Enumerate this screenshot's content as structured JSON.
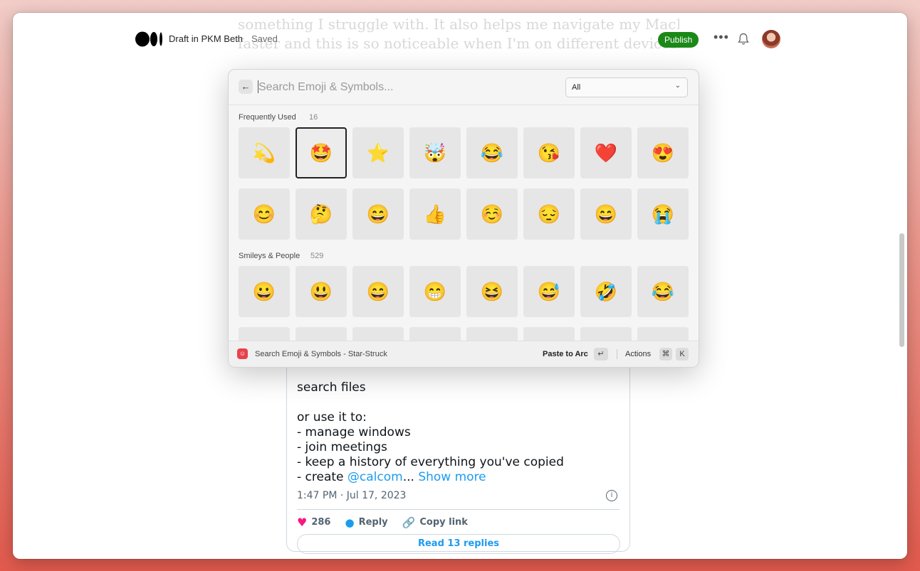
{
  "background_text": {
    "line1": "something I struggle with. It also helps me navigate my MacBook way",
    "line2": "faster and this is so noticeable when I'm on different devices."
  },
  "header": {
    "draft_label": "Draft in PKM Beth",
    "status": "Saved",
    "publish_label": "Publish",
    "more_label": "•••"
  },
  "picker": {
    "search_placeholder": "Search Emoji & Symbols...",
    "filter_value": "All",
    "frequent": {
      "label": "Frequently Used",
      "count": "16",
      "emojis": [
        "💫",
        "🤩",
        "⭐",
        "🤯",
        "😂",
        "😘",
        "❤️",
        "😍",
        "😊",
        "🤔",
        "😄",
        "👍",
        "☺️",
        "😔",
        "😄",
        "😭"
      ]
    },
    "smileys": {
      "label": "Smileys & People",
      "count": "529",
      "emojis": [
        "😀",
        "😃",
        "😄",
        "😁",
        "😆",
        "😅",
        "🤣",
        "😂"
      ]
    },
    "footer": {
      "title": "Search Emoji & Symbols - Star-Struck",
      "paste_label": "Paste to Arc",
      "enter_key": "↵",
      "actions_label": "Actions",
      "cmd_key": "⌘",
      "k_key": "K"
    }
  },
  "tweet": {
    "line_search": "search files",
    "line_or": "or use it to:",
    "line_1": "- manage windows",
    "line_2": "- join meetings",
    "line_3": "- keep a history of everything you've copied",
    "line_4_prefix": "- create ",
    "line_4_mention": "@calcom",
    "line_4_ellipsis": "...",
    "show_more": "Show more",
    "timestamp": "1:47 PM · Jul 17, 2023",
    "likes": "286",
    "reply_label": "Reply",
    "copy_label": "Copy link",
    "read_replies": "Read 13 replies"
  }
}
